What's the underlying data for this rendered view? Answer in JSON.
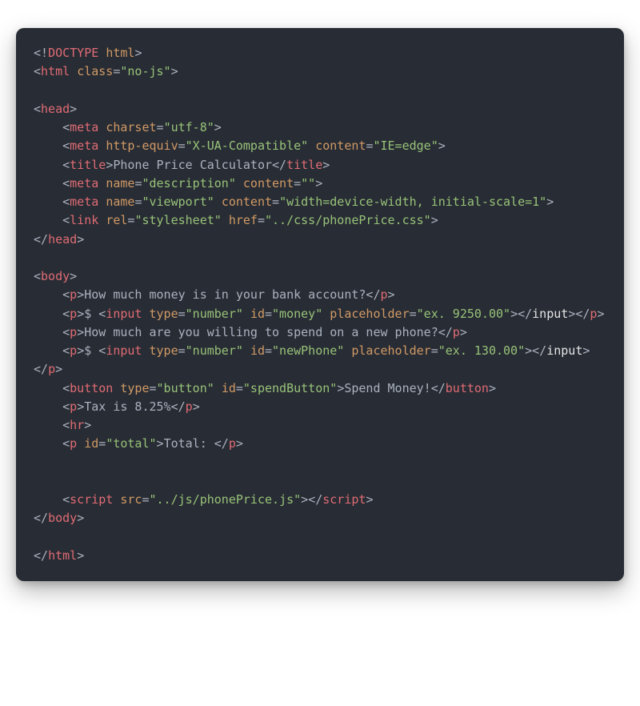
{
  "tokens": [
    {
      "c": "punct",
      "t": "<!"
    },
    {
      "c": "tag",
      "t": "DOCTYPE"
    },
    {
      "t": " "
    },
    {
      "c": "attr",
      "t": "html"
    },
    {
      "c": "punct",
      "t": ">"
    },
    {
      "nl": true
    },
    {
      "c": "punct",
      "t": "<"
    },
    {
      "c": "tag",
      "t": "html"
    },
    {
      "t": " "
    },
    {
      "c": "attr",
      "t": "class"
    },
    {
      "c": "punct",
      "t": "="
    },
    {
      "c": "string",
      "t": "\"no-js\""
    },
    {
      "c": "punct",
      "t": ">"
    },
    {
      "nl": true
    },
    {
      "nl": true
    },
    {
      "c": "punct",
      "t": "<"
    },
    {
      "c": "tag",
      "t": "head"
    },
    {
      "c": "punct",
      "t": ">"
    },
    {
      "nl": true
    },
    {
      "t": "    "
    },
    {
      "c": "punct",
      "t": "<"
    },
    {
      "c": "tag",
      "t": "meta"
    },
    {
      "t": " "
    },
    {
      "c": "attr",
      "t": "charset"
    },
    {
      "c": "punct",
      "t": "="
    },
    {
      "c": "string",
      "t": "\"utf-8\""
    },
    {
      "c": "punct",
      "t": ">"
    },
    {
      "nl": true
    },
    {
      "t": "    "
    },
    {
      "c": "punct",
      "t": "<"
    },
    {
      "c": "tag",
      "t": "meta"
    },
    {
      "t": " "
    },
    {
      "c": "attr",
      "t": "http-equiv"
    },
    {
      "c": "punct",
      "t": "="
    },
    {
      "c": "string",
      "t": "\"X-UA-Compatible\""
    },
    {
      "t": " "
    },
    {
      "c": "attr",
      "t": "content"
    },
    {
      "c": "punct",
      "t": "="
    },
    {
      "c": "string",
      "t": "\"IE=edge\""
    },
    {
      "c": "punct",
      "t": ">"
    },
    {
      "nl": true
    },
    {
      "t": "    "
    },
    {
      "c": "punct",
      "t": "<"
    },
    {
      "c": "tag",
      "t": "title"
    },
    {
      "c": "punct",
      "t": ">"
    },
    {
      "c": "text",
      "t": "Phone Price Calculator"
    },
    {
      "c": "punct",
      "t": "</"
    },
    {
      "c": "tag",
      "t": "title"
    },
    {
      "c": "punct",
      "t": ">"
    },
    {
      "nl": true
    },
    {
      "t": "    "
    },
    {
      "c": "punct",
      "t": "<"
    },
    {
      "c": "tag",
      "t": "meta"
    },
    {
      "t": " "
    },
    {
      "c": "attr",
      "t": "name"
    },
    {
      "c": "punct",
      "t": "="
    },
    {
      "c": "string",
      "t": "\"description\""
    },
    {
      "t": " "
    },
    {
      "c": "attr",
      "t": "content"
    },
    {
      "c": "punct",
      "t": "="
    },
    {
      "c": "string",
      "t": "\"\""
    },
    {
      "c": "punct",
      "t": ">"
    },
    {
      "nl": true
    },
    {
      "t": "    "
    },
    {
      "c": "punct",
      "t": "<"
    },
    {
      "c": "tag",
      "t": "meta"
    },
    {
      "t": " "
    },
    {
      "c": "attr",
      "t": "name"
    },
    {
      "c": "punct",
      "t": "="
    },
    {
      "c": "string",
      "t": "\"viewport\""
    },
    {
      "t": " "
    },
    {
      "c": "attr",
      "t": "content"
    },
    {
      "c": "punct",
      "t": "="
    },
    {
      "c": "string",
      "t": "\"width=device-width, initial-scale=1\""
    },
    {
      "c": "punct",
      "t": ">"
    },
    {
      "nl": true
    },
    {
      "t": "    "
    },
    {
      "c": "punct",
      "t": "<"
    },
    {
      "c": "tag",
      "t": "link"
    },
    {
      "t": " "
    },
    {
      "c": "attr",
      "t": "rel"
    },
    {
      "c": "punct",
      "t": "="
    },
    {
      "c": "string",
      "t": "\"stylesheet\""
    },
    {
      "t": " "
    },
    {
      "c": "attr",
      "t": "href"
    },
    {
      "c": "punct",
      "t": "="
    },
    {
      "c": "string",
      "t": "\"../css/phonePrice.css\""
    },
    {
      "c": "punct",
      "t": ">"
    },
    {
      "nl": true
    },
    {
      "c": "punct",
      "t": "</"
    },
    {
      "c": "tag",
      "t": "head"
    },
    {
      "c": "punct",
      "t": ">"
    },
    {
      "nl": true
    },
    {
      "nl": true
    },
    {
      "c": "punct",
      "t": "<"
    },
    {
      "c": "tag",
      "t": "body"
    },
    {
      "c": "punct",
      "t": ">"
    },
    {
      "nl": true
    },
    {
      "t": "    "
    },
    {
      "c": "punct",
      "t": "<"
    },
    {
      "c": "tag",
      "t": "p"
    },
    {
      "c": "punct",
      "t": ">"
    },
    {
      "c": "text",
      "t": "How much money is in your bank account?"
    },
    {
      "c": "punct",
      "t": "</"
    },
    {
      "c": "tag",
      "t": "p"
    },
    {
      "c": "punct",
      "t": ">"
    },
    {
      "nl": true
    },
    {
      "t": "    "
    },
    {
      "c": "punct",
      "t": "<"
    },
    {
      "c": "tag",
      "t": "p"
    },
    {
      "c": "punct",
      "t": ">"
    },
    {
      "c": "text",
      "t": "$ "
    },
    {
      "c": "punct",
      "t": "<"
    },
    {
      "c": "tag",
      "t": "input"
    },
    {
      "t": " "
    },
    {
      "c": "attr",
      "t": "type"
    },
    {
      "c": "punct",
      "t": "="
    },
    {
      "c": "string",
      "t": "\"number\""
    },
    {
      "t": " "
    },
    {
      "c": "attr",
      "t": "id"
    },
    {
      "c": "punct",
      "t": "="
    },
    {
      "c": "string",
      "t": "\"money\""
    },
    {
      "t": " "
    },
    {
      "c": "attr",
      "t": "placeholder"
    },
    {
      "c": "punct",
      "t": "="
    },
    {
      "c": "string",
      "t": "\"ex. 9250.00\""
    },
    {
      "c": "punct",
      "t": ">"
    },
    {
      "c": "punct",
      "t": "</"
    },
    {
      "c": "white",
      "t": "input"
    },
    {
      "c": "punct",
      "t": ">"
    },
    {
      "c": "punct",
      "t": "</"
    },
    {
      "c": "tag",
      "t": "p"
    },
    {
      "c": "punct",
      "t": ">"
    },
    {
      "nl": true
    },
    {
      "t": "    "
    },
    {
      "c": "punct",
      "t": "<"
    },
    {
      "c": "tag",
      "t": "p"
    },
    {
      "c": "punct",
      "t": ">"
    },
    {
      "c": "text",
      "t": "How much are you willing to spend on a new phone?"
    },
    {
      "c": "punct",
      "t": "</"
    },
    {
      "c": "tag",
      "t": "p"
    },
    {
      "c": "punct",
      "t": ">"
    },
    {
      "nl": true
    },
    {
      "t": "    "
    },
    {
      "c": "punct",
      "t": "<"
    },
    {
      "c": "tag",
      "t": "p"
    },
    {
      "c": "punct",
      "t": ">"
    },
    {
      "c": "text",
      "t": "$ "
    },
    {
      "c": "punct",
      "t": "<"
    },
    {
      "c": "tag",
      "t": "input"
    },
    {
      "t": " "
    },
    {
      "c": "attr",
      "t": "type"
    },
    {
      "c": "punct",
      "t": "="
    },
    {
      "c": "string",
      "t": "\"number\""
    },
    {
      "t": " "
    },
    {
      "c": "attr",
      "t": "id"
    },
    {
      "c": "punct",
      "t": "="
    },
    {
      "c": "string",
      "t": "\"newPhone\""
    },
    {
      "t": " "
    },
    {
      "c": "attr",
      "t": "placeholder"
    },
    {
      "c": "punct",
      "t": "="
    },
    {
      "c": "string",
      "t": "\"ex. 130.00\""
    },
    {
      "c": "punct",
      "t": ">"
    },
    {
      "c": "punct",
      "t": "</"
    },
    {
      "c": "white",
      "t": "input"
    },
    {
      "c": "punct",
      "t": ">"
    },
    {
      "c": "punct",
      "t": "</"
    },
    {
      "c": "tag",
      "t": "p"
    },
    {
      "c": "punct",
      "t": ">"
    },
    {
      "nl": true
    },
    {
      "t": "    "
    },
    {
      "c": "punct",
      "t": "<"
    },
    {
      "c": "tag",
      "t": "button"
    },
    {
      "t": " "
    },
    {
      "c": "attr",
      "t": "type"
    },
    {
      "c": "punct",
      "t": "="
    },
    {
      "c": "string",
      "t": "\"button\""
    },
    {
      "t": " "
    },
    {
      "c": "attr",
      "t": "id"
    },
    {
      "c": "punct",
      "t": "="
    },
    {
      "c": "string",
      "t": "\"spendButton\""
    },
    {
      "c": "punct",
      "t": ">"
    },
    {
      "c": "text",
      "t": "Spend Money!"
    },
    {
      "c": "punct",
      "t": "</"
    },
    {
      "c": "tag",
      "t": "button"
    },
    {
      "c": "punct",
      "t": ">"
    },
    {
      "nl": true
    },
    {
      "t": "    "
    },
    {
      "c": "punct",
      "t": "<"
    },
    {
      "c": "tag",
      "t": "p"
    },
    {
      "c": "punct",
      "t": ">"
    },
    {
      "c": "text",
      "t": "Tax is 8.25%"
    },
    {
      "c": "punct",
      "t": "</"
    },
    {
      "c": "tag",
      "t": "p"
    },
    {
      "c": "punct",
      "t": ">"
    },
    {
      "nl": true
    },
    {
      "t": "    "
    },
    {
      "c": "punct",
      "t": "<"
    },
    {
      "c": "tag",
      "t": "hr"
    },
    {
      "c": "punct",
      "t": ">"
    },
    {
      "nl": true
    },
    {
      "t": "    "
    },
    {
      "c": "punct",
      "t": "<"
    },
    {
      "c": "tag",
      "t": "p"
    },
    {
      "t": " "
    },
    {
      "c": "attr",
      "t": "id"
    },
    {
      "c": "punct",
      "t": "="
    },
    {
      "c": "string",
      "t": "\"total\""
    },
    {
      "c": "punct",
      "t": ">"
    },
    {
      "c": "text",
      "t": "Total: "
    },
    {
      "c": "punct",
      "t": "</"
    },
    {
      "c": "tag",
      "t": "p"
    },
    {
      "c": "punct",
      "t": ">"
    },
    {
      "nl": true
    },
    {
      "nl": true
    },
    {
      "nl": true
    },
    {
      "t": "    "
    },
    {
      "c": "punct",
      "t": "<"
    },
    {
      "c": "tag",
      "t": "script"
    },
    {
      "t": " "
    },
    {
      "c": "attr",
      "t": "src"
    },
    {
      "c": "punct",
      "t": "="
    },
    {
      "c": "string",
      "t": "\"../js/phonePrice.js\""
    },
    {
      "c": "punct",
      "t": ">"
    },
    {
      "c": "punct",
      "t": "</"
    },
    {
      "c": "tag",
      "t": "script"
    },
    {
      "c": "punct",
      "t": ">"
    },
    {
      "nl": true
    },
    {
      "c": "punct",
      "t": "</"
    },
    {
      "c": "tag",
      "t": "body"
    },
    {
      "c": "punct",
      "t": ">"
    },
    {
      "nl": true
    },
    {
      "nl": true
    },
    {
      "c": "punct",
      "t": "</"
    },
    {
      "c": "tag",
      "t": "html"
    },
    {
      "c": "punct",
      "t": ">"
    }
  ]
}
